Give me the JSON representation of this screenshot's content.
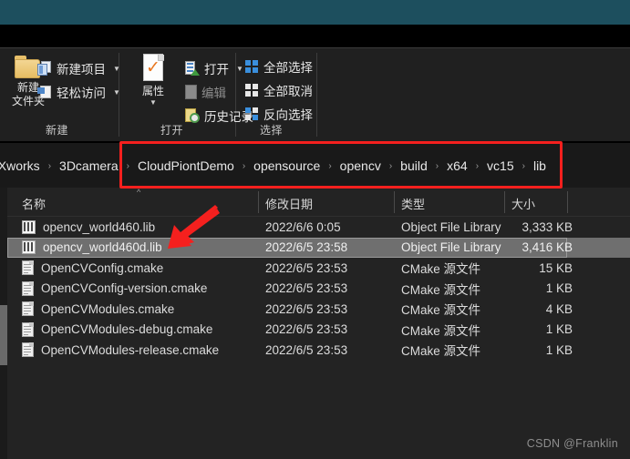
{
  "window": {
    "title_band_color": "#1d4f5e",
    "background": "#232323"
  },
  "ribbon": {
    "groups": [
      {
        "name": "new",
        "label": "新建",
        "big_button": {
          "label_line1": "新建",
          "label_line2": "文件夹",
          "icon": "folder-icon"
        },
        "small_buttons": [
          {
            "label": "新建项目",
            "icon": "new-item-icon",
            "has_caret": true,
            "dimmed": false
          },
          {
            "label": "轻松访问",
            "icon": "easy-access-icon",
            "has_caret": true,
            "dimmed": false
          }
        ]
      },
      {
        "name": "open",
        "label": "打开",
        "big_button": {
          "label_line1": "属性",
          "label_line2": "",
          "icon": "properties-icon",
          "has_caret": true
        },
        "small_buttons": [
          {
            "label": "打开",
            "icon": "open-icon",
            "has_caret": true,
            "dimmed": false
          },
          {
            "label": "编辑",
            "icon": "edit-icon",
            "has_caret": false,
            "dimmed": true
          },
          {
            "label": "历史记录",
            "icon": "history-icon",
            "has_caret": false,
            "dimmed": false
          }
        ]
      },
      {
        "name": "select",
        "label": "选择",
        "small_buttons": [
          {
            "label": "全部选择",
            "icon": "select-all-icon",
            "has_caret": false,
            "dimmed": false
          },
          {
            "label": "全部取消",
            "icon": "select-none-icon",
            "has_caret": false,
            "dimmed": false
          },
          {
            "label": "反向选择",
            "icon": "invert-selection-icon",
            "has_caret": false,
            "dimmed": false
          }
        ]
      }
    ]
  },
  "breadcrumb": {
    "separator": "›",
    "items": [
      {
        "label": "nXworks"
      },
      {
        "label": "3Dcamera"
      },
      {
        "label": "CloudPiontDemo"
      },
      {
        "label": "opensource"
      },
      {
        "label": "opencv"
      },
      {
        "label": "build"
      },
      {
        "label": "x64"
      },
      {
        "label": "vc15"
      },
      {
        "label": "lib"
      }
    ]
  },
  "file_list": {
    "columns": [
      {
        "key": "name",
        "label": "名称",
        "sorted": true,
        "sort_caret": "^"
      },
      {
        "key": "date",
        "label": "修改日期"
      },
      {
        "key": "type",
        "label": "类型"
      },
      {
        "key": "size",
        "label": "大小"
      }
    ],
    "rows": [
      {
        "icon": "lib-file-icon",
        "name": "opencv_world460.lib",
        "date": "2022/6/6 0:05",
        "type": "Object File Library",
        "size": "3,333 KB",
        "selected": false
      },
      {
        "icon": "lib-file-icon",
        "name": "opencv_world460d.lib",
        "date": "2022/6/5 23:58",
        "type": "Object File Library",
        "size": "3,416 KB",
        "selected": true
      },
      {
        "icon": "cmake-file-icon",
        "name": "OpenCVConfig.cmake",
        "date": "2022/6/5 23:53",
        "type": "CMake 源文件",
        "size": "15 KB",
        "selected": false
      },
      {
        "icon": "cmake-file-icon",
        "name": "OpenCVConfig-version.cmake",
        "date": "2022/6/5 23:53",
        "type": "CMake 源文件",
        "size": "1 KB",
        "selected": false
      },
      {
        "icon": "cmake-file-icon",
        "name": "OpenCVModules.cmake",
        "date": "2022/6/5 23:53",
        "type": "CMake 源文件",
        "size": "4 KB",
        "selected": false
      },
      {
        "icon": "cmake-file-icon",
        "name": "OpenCVModules-debug.cmake",
        "date": "2022/6/5 23:53",
        "type": "CMake 源文件",
        "size": "1 KB",
        "selected": false
      },
      {
        "icon": "cmake-file-icon",
        "name": "OpenCVModules-release.cmake",
        "date": "2022/6/5 23:53",
        "type": "CMake 源文件",
        "size": "1 KB",
        "selected": false
      }
    ]
  },
  "annotations": {
    "highlight_color": "#f5201e",
    "rect_target": "breadcrumb",
    "arrow_target": "opencv_world460d.lib"
  },
  "watermark": {
    "text": "CSDN @Franklin"
  }
}
